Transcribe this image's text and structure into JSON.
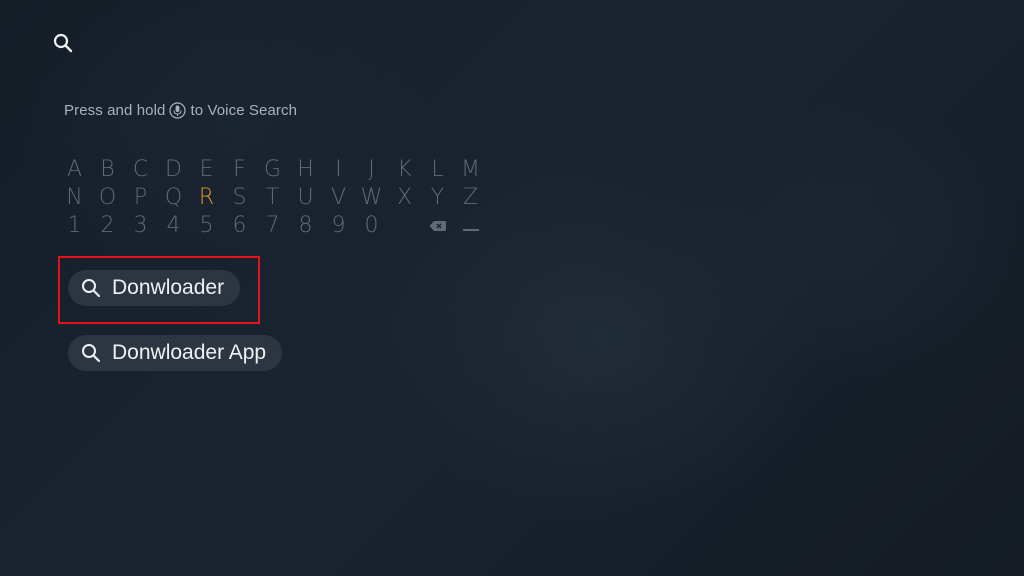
{
  "voice_hint": {
    "before": "Press and hold",
    "after": "to Voice Search"
  },
  "keyboard": {
    "rows": [
      [
        "A",
        "B",
        "C",
        "D",
        "E",
        "F",
        "G",
        "H",
        "I",
        "J",
        "K",
        "L",
        "M"
      ],
      [
        "N",
        "O",
        "P",
        "Q",
        "R",
        "S",
        "T",
        "U",
        "V",
        "W",
        "X",
        "Y",
        "Z"
      ],
      [
        "1",
        "2",
        "3",
        "4",
        "5",
        "6",
        "7",
        "8",
        "9",
        "0"
      ]
    ],
    "active_key": "R"
  },
  "suggestions": [
    "Donwloader",
    "Donwloader App"
  ],
  "colors": {
    "active_key": "#d99a2b",
    "highlight": "#e0141a"
  }
}
